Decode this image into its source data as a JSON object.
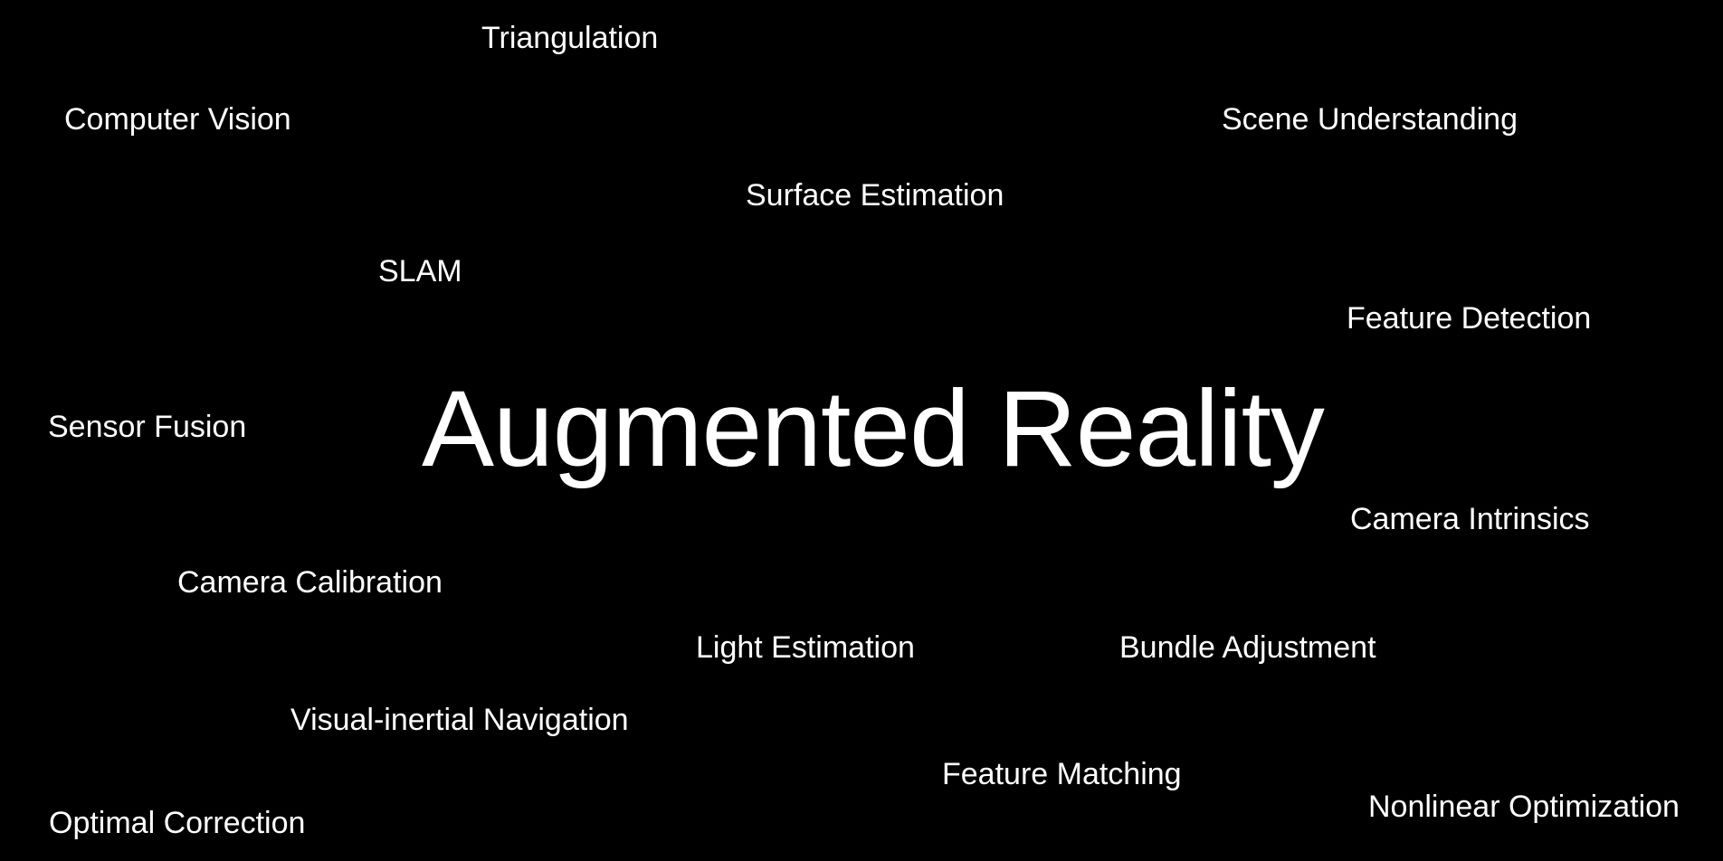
{
  "slide": {
    "background": "#000000",
    "text_color": "#ffffff",
    "title": "Augmented Reality",
    "terms": {
      "triangulation": "Triangulation",
      "computer_vision": "Computer Vision",
      "scene_understanding": "Scene Understanding",
      "surface_estimation": "Surface Estimation",
      "slam": "SLAM",
      "feature_detection": "Feature Detection",
      "sensor_fusion": "Sensor Fusion",
      "camera_intrinsics": "Camera Intrinsics",
      "camera_calibration": "Camera Calibration",
      "light_estimation": "Light Estimation",
      "bundle_adjustment": "Bundle Adjustment",
      "visual_inertial_navigation": "Visual-inertial Navigation",
      "feature_matching": "Feature Matching",
      "nonlinear_optimization": "Nonlinear Optimization",
      "optimal_correction": "Optimal Correction"
    }
  }
}
